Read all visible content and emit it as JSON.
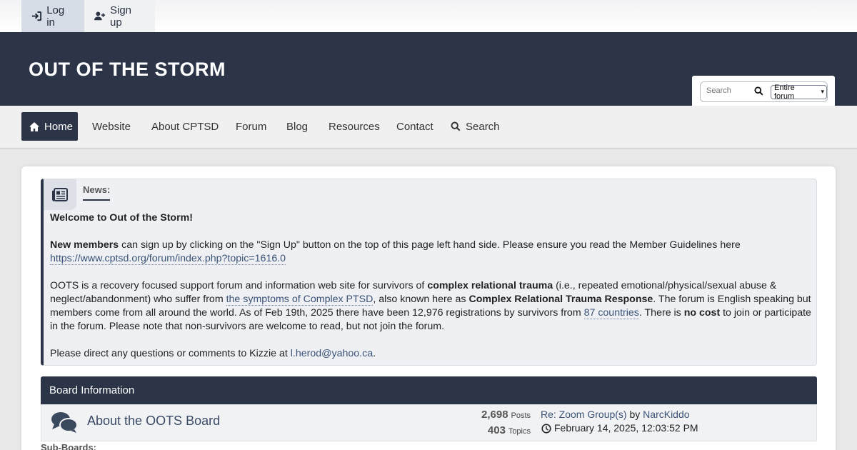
{
  "userbar": {
    "login_label": "Log in",
    "signup_label": "Sign up"
  },
  "header": {
    "site_title": "OUT OF THE STORM",
    "search_placeholder": "Search",
    "search_scope": "Entire forum"
  },
  "nav": {
    "items": [
      {
        "label": "Home"
      },
      {
        "label": "Website"
      },
      {
        "label": "About CPTSD"
      },
      {
        "label": "Forum"
      },
      {
        "label": "Blog"
      },
      {
        "label": "Resources"
      },
      {
        "label": "Contact"
      },
      {
        "label": "Search"
      }
    ]
  },
  "news": {
    "label": "News:",
    "welcome": "Welcome to Out of the Storm!",
    "p1_bold": "New members",
    "p1_text": " can sign up by clicking on the \"Sign Up\" button on the top of this page left hand side.  Please ensure you read the Member Guidelines here ",
    "p1_link": "https://www.cptsd.org/forum/index.php?topic=1616.0",
    "p2_a": "OOTS is a recovery focused support forum and information web site for survivors of ",
    "p2_b_bold": "complex relational trauma",
    "p2_c": " (i.e., repeated emotional/physical/sexual abuse & neglect/abandonment) who suffer from ",
    "p2_d_link": "the symptoms of Complex PTSD",
    "p2_e": ", also known here as ",
    "p2_f_bold": "Complex Relational Trauma Response",
    "p2_g": ".  The forum is English speaking but members come from all around the world. As of Feb 19th, 2025 there have been 12,976 registrations by survivors from ",
    "p2_h_link": "87 countries",
    "p2_i": ".  There is ",
    "p2_j_bold": "no cost",
    "p2_k": " to join or participate in the forum.   Please note that non-survivors are welcome to read, but not join the forum.",
    "p3_text": "Please direct any questions or comments to Kizzie at ",
    "p3_link": "l.herod@yahoo.ca",
    "p3_end": "."
  },
  "board": {
    "section_title": "Board Information",
    "name": "About the OOTS Board",
    "posts_count": "2,698",
    "posts_label": "Posts",
    "topics_count": "403",
    "topics_label": "Topics",
    "lastpost_title": "Re: Zoom Group(s)",
    "lastpost_by": " by ",
    "lastpost_author": "NarcKiddo",
    "lastpost_date": "February 14, 2025, 12:03:52 PM",
    "subboards_label": "Sub-Boards:"
  },
  "colors": {
    "header_bg": "#2b3547",
    "link": "#3a5276",
    "nav_active": "#2b3547"
  }
}
